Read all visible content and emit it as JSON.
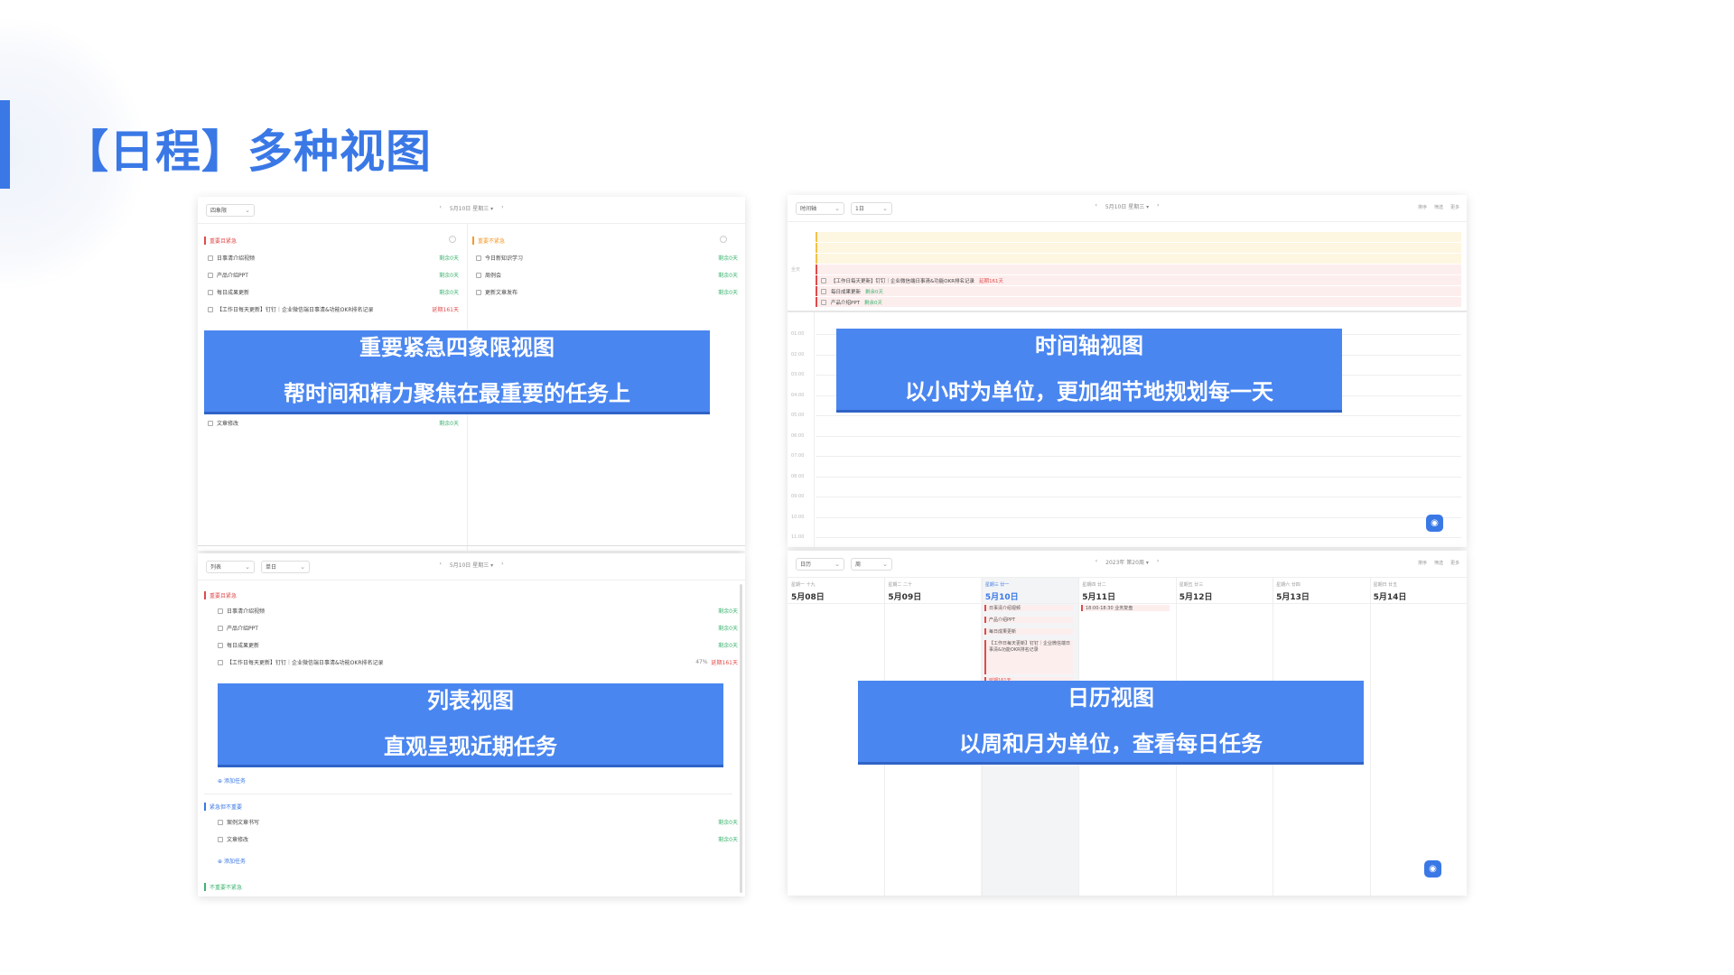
{
  "title": "【日程】多种视图",
  "panels": {
    "quadrant": {
      "view_select": "四象限",
      "date_nav": "5月10日 星期三 ▾",
      "q1_label": "重要且紧急",
      "q2_label": "重要不紧急",
      "q1_tasks": [
        {
          "text": "日事清介绍视频",
          "remain": "剩余0天"
        },
        {
          "text": "产品介绍PPT",
          "remain": "剩余0天"
        },
        {
          "text": "每日成果更新",
          "remain": "剩余0天"
        },
        {
          "text": "【工作日每天更新】钉钉｜企业微信端日事清&功能OKR排名记录",
          "overdue": "延期161天"
        }
      ],
      "q2_tasks": [
        {
          "text": "今日新知识学习",
          "remain": "剩余0天"
        },
        {
          "text": "周例会",
          "remain": "剩余0天"
        },
        {
          "text": "更新文章发布",
          "remain": "剩余0天"
        }
      ],
      "q3_tasks": [
        {
          "text": "文章修改",
          "remain": "剩余0天"
        }
      ],
      "overlay_title": "重要紧急四象限视图",
      "overlay_sub": "帮时间和精力聚焦在最重要的任务上"
    },
    "timeline": {
      "view_select": "时间轴",
      "range_select": "1日",
      "date_nav": "5月10日 星期三 ▾",
      "toolbar_right": [
        "排序",
        "筛选",
        "更多"
      ],
      "allday_label": "全天",
      "rows": [
        {
          "text": "【工作日每天更新】钉钉｜企业微信端日事清&功能OKR排名记录",
          "status": "延期161天"
        },
        {
          "text": "每日成果更新",
          "status": "剩余0天"
        },
        {
          "text": "产品介绍PPT",
          "status": "剩余0天"
        }
      ],
      "hours": [
        "01:00",
        "02:00",
        "03:00",
        "04:00",
        "05:00",
        "06:00",
        "07:00",
        "08:00",
        "09:00",
        "10:00",
        "11:00"
      ],
      "overlay_title": "时间轴视图",
      "overlay_sub": "以小时为单位，更加细节地规划每一天"
    },
    "list": {
      "view_select": "列表",
      "range_select": "单日",
      "date_nav": "5月10日 星期三 ▾",
      "sec1_label": "重要且紧急",
      "sec1_tasks": [
        {
          "text": "日事清介绍视频",
          "remain": "剩余0天"
        },
        {
          "text": "产品介绍PPT",
          "remain": "剩余0天"
        },
        {
          "text": "每日成果更新",
          "remain": "剩余0天"
        },
        {
          "text": "【工作日每天更新】钉钉｜企业微信端日事清&功能OKR排名记录",
          "progress": "47%",
          "overdue": "延期161天"
        }
      ],
      "add_task": "添加任务",
      "sec3_label": "紧急但不重要",
      "sec3_tasks": [
        {
          "text": "案例文章书写",
          "remain": "剩余0天"
        },
        {
          "text": "文章修改",
          "remain": "剩余0天"
        }
      ],
      "sec4_label": "不重要不紧急",
      "overlay_title": "列表视图",
      "overlay_sub": "直观呈现近期任务"
    },
    "calendar": {
      "view_select": "日历",
      "range_select": "周",
      "date_nav": "2023年 第20周 ▾",
      "toolbar_right": [
        "排序",
        "筛选",
        "更多"
      ],
      "days": [
        {
          "weekday": "星期一 十九",
          "date": "5月08日"
        },
        {
          "weekday": "星期二 二十",
          "date": "5月09日"
        },
        {
          "weekday": "星期三 廿一",
          "date": "5月10日"
        },
        {
          "weekday": "星期四 廿二",
          "date": "5月11日"
        },
        {
          "weekday": "星期五 廿三",
          "date": "5月12日"
        },
        {
          "weekday": "星期六 廿四",
          "date": "5月13日"
        },
        {
          "weekday": "星期日 廿五",
          "date": "5月14日"
        }
      ],
      "events": [
        "日事清介绍视频",
        "产品介绍PPT",
        "每日成果更新",
        "【工作日每天更新】钉钉｜企业微信端日事清&功能OKR排名记录"
      ],
      "event_overdue": "延期161天",
      "thu_event": "18:00-18:30 业务复盘",
      "overlay_title": "日历视图",
      "overlay_sub": "以周和月为单位，查看每日任务"
    }
  },
  "colors": {
    "accent": "#3a78e6",
    "overlay": "#4a86f0",
    "urgent": "#e04b4b",
    "remain": "#3eb370"
  }
}
